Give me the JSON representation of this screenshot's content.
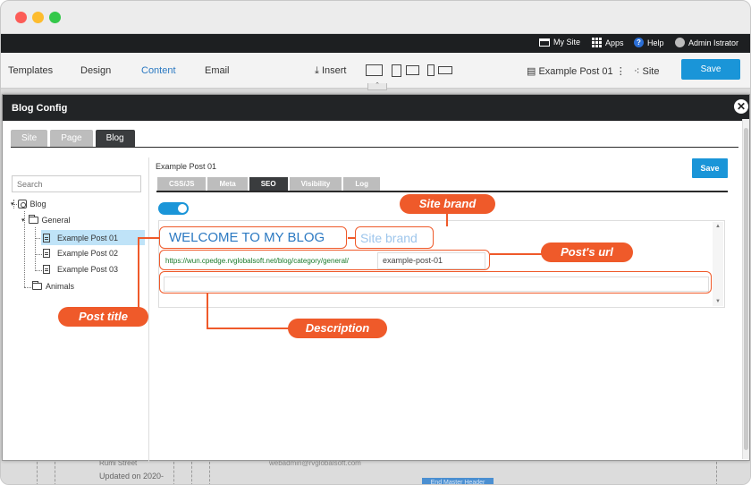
{
  "adminbar": {
    "my_site": "My Site",
    "apps": "Apps",
    "help": "Help",
    "user": "Admin Istrator"
  },
  "toolbar": {
    "templates": "Templates",
    "design": "Design",
    "content": "Content",
    "email": "Email",
    "insert": "Insert",
    "page": "Example Post 01",
    "site": "Site",
    "save": "Save"
  },
  "background": {
    "line1": "Rumi Street",
    "line2": "Updated on 2020-",
    "email": "webadmin@rvglobalsoft.com",
    "badge": "End Master Header"
  },
  "modal": {
    "title": "Blog Config",
    "tabs": [
      {
        "label": "Site"
      },
      {
        "label": "Page"
      },
      {
        "label": "Blog"
      }
    ],
    "search_placeholder": "Search",
    "tree": {
      "root": "Blog",
      "general": "General",
      "posts": [
        "Example Post 01",
        "Example Post 02",
        "Example Post 03"
      ],
      "animals": "Animals"
    },
    "page_name": "Example Post 01",
    "save": "Save",
    "sub_tabs": [
      "CSS/JS",
      "Meta",
      "SEO",
      "Visibility",
      "Log"
    ],
    "seo": {
      "title": "WELCOME TO MY BLOG",
      "site_brand": "Site brand",
      "url_prefix": "https://wun.cpedge.rvglobalsoft.net/blog/category/general/",
      "slug": "example-post-01",
      "description": ""
    }
  },
  "annotations": {
    "site_brand": "Site brand",
    "posts_url": "Post's url",
    "post_title": "Post title",
    "description": "Description"
  },
  "colors": {
    "accent": "#1a95d8",
    "annotation": "#ef5a2a",
    "title_blue": "#2b79c2"
  }
}
